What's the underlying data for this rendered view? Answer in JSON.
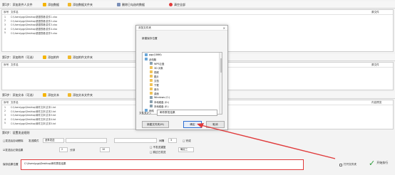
{
  "toolbars": [
    {
      "label": "第1步：添加发件人文件",
      "add": "添加数据",
      "add_folder": "添加数据文件夹",
      "extra": "删除已勾选的数据",
      "clear": "清空全部"
    },
    {
      "label": "第2步：添加附件（可选）",
      "add": "添加附件",
      "add_folder": "添加附件文件夹"
    },
    {
      "label": "第3步：添加文本（可选）",
      "add": "添加文本",
      "add_folder": "添加文本文件夹"
    }
  ],
  "grid_headers": {
    "no": "序号",
    "name": "文件名",
    "right1": "原文件",
    "right2": "内容预览"
  },
  "grid1_rows": [
    {
      "n": "1",
      "path": "C:\\Users\\pgp\\Desktop\\数据表格\\发件1.xlsx"
    },
    {
      "n": "2",
      "path": "C:\\Users\\pgp\\Desktop\\数据表格\\发件2.xlsx"
    },
    {
      "n": "3",
      "path": "C:\\Users\\pgp\\Desktop\\数据表格\\发件3.xlsx"
    },
    {
      "n": "4",
      "path": "C:\\Users\\pgp\\Desktop\\数据表格\\发件4.xlsx"
    },
    {
      "n": "5",
      "path": "C:\\Users\\pgp\\Desktop\\数据表格\\发件5.xlsx"
    }
  ],
  "grid3_rows": [
    {
      "n": "1",
      "path": "C:\\Users\\pgp\\Desktop\\邮件文本\\文本1.txt"
    },
    {
      "n": "2",
      "path": "C:\\Users\\pgp\\Desktop\\邮件文本\\文本2.txt"
    },
    {
      "n": "3",
      "path": "C:\\Users\\pgp\\Desktop\\邮件文本\\文本3.txt"
    },
    {
      "n": "4",
      "path": "C:\\Users\\pgp\\Desktop\\邮件文本\\文本4.txt"
    },
    {
      "n": "5",
      "path": "C:\\Users\\pgp\\Desktop\\邮件文本\\文本5.txt"
    }
  ],
  "settings": {
    "title": "第4步：设置发送规则",
    "row1_left": "□发送后自动删除",
    "row1_mode": "发送模式",
    "row1_mode_value": "逐条发送",
    "row1_mid": "间隔",
    "row1_mid_value": "3",
    "row1_right": "□ 完成",
    "row2_left": "☑发送后记录结果",
    "row2_a": "2",
    "row2_b": "分钟",
    "row2_c": "10",
    "row2_d": "□ 不发送重复",
    "row2_e": "□ 跳过已发送",
    "row2_f": "确定三"
  },
  "output": {
    "label": "保存结果位置",
    "path": "C:\\Users\\pgp\\Desktop\\邮件群发结果",
    "open_label": "打开文件夹",
    "start_label": "开始执行"
  },
  "dialog": {
    "title": "浏览文件夹",
    "close": "×",
    "subtitle": "新建保存位置",
    "tree": [
      {
        "label": "pgp(1866)",
        "kind": "user",
        "depth": 0
      },
      {
        "label": "此电脑",
        "kind": "pc",
        "depth": 0
      },
      {
        "label": "WPS云盘",
        "kind": "drv",
        "depth": 1
      },
      {
        "label": "3D 对象",
        "kind": "folder",
        "depth": 1
      },
      {
        "label": "视频",
        "kind": "folder",
        "depth": 1
      },
      {
        "label": "图片",
        "kind": "folder",
        "depth": 1
      },
      {
        "label": "文档",
        "kind": "folder",
        "depth": 1
      },
      {
        "label": "下载",
        "kind": "folder",
        "depth": 1
      },
      {
        "label": "音乐",
        "kind": "folder",
        "depth": 1
      },
      {
        "label": "桌面",
        "kind": "folder",
        "depth": 1
      },
      {
        "label": "Windows (C:)",
        "kind": "drv",
        "depth": 1
      },
      {
        "label": "本地磁盘 (D:)",
        "kind": "drv",
        "depth": 1
      },
      {
        "label": "本地磁盘 (E:)",
        "kind": "drv",
        "depth": 1
      },
      {
        "label": "网络",
        "kind": "pc",
        "depth": 0
      }
    ],
    "folder_label": "文件夹(F):",
    "folder_value": "邮件群发结果",
    "new_folder": "新建文件夹(M)",
    "ok": "确定",
    "cancel": "取消"
  },
  "colors": {
    "arrow": "#e0393a",
    "highlight_box": "#e0393a",
    "start_check": "#2e9b3a"
  }
}
